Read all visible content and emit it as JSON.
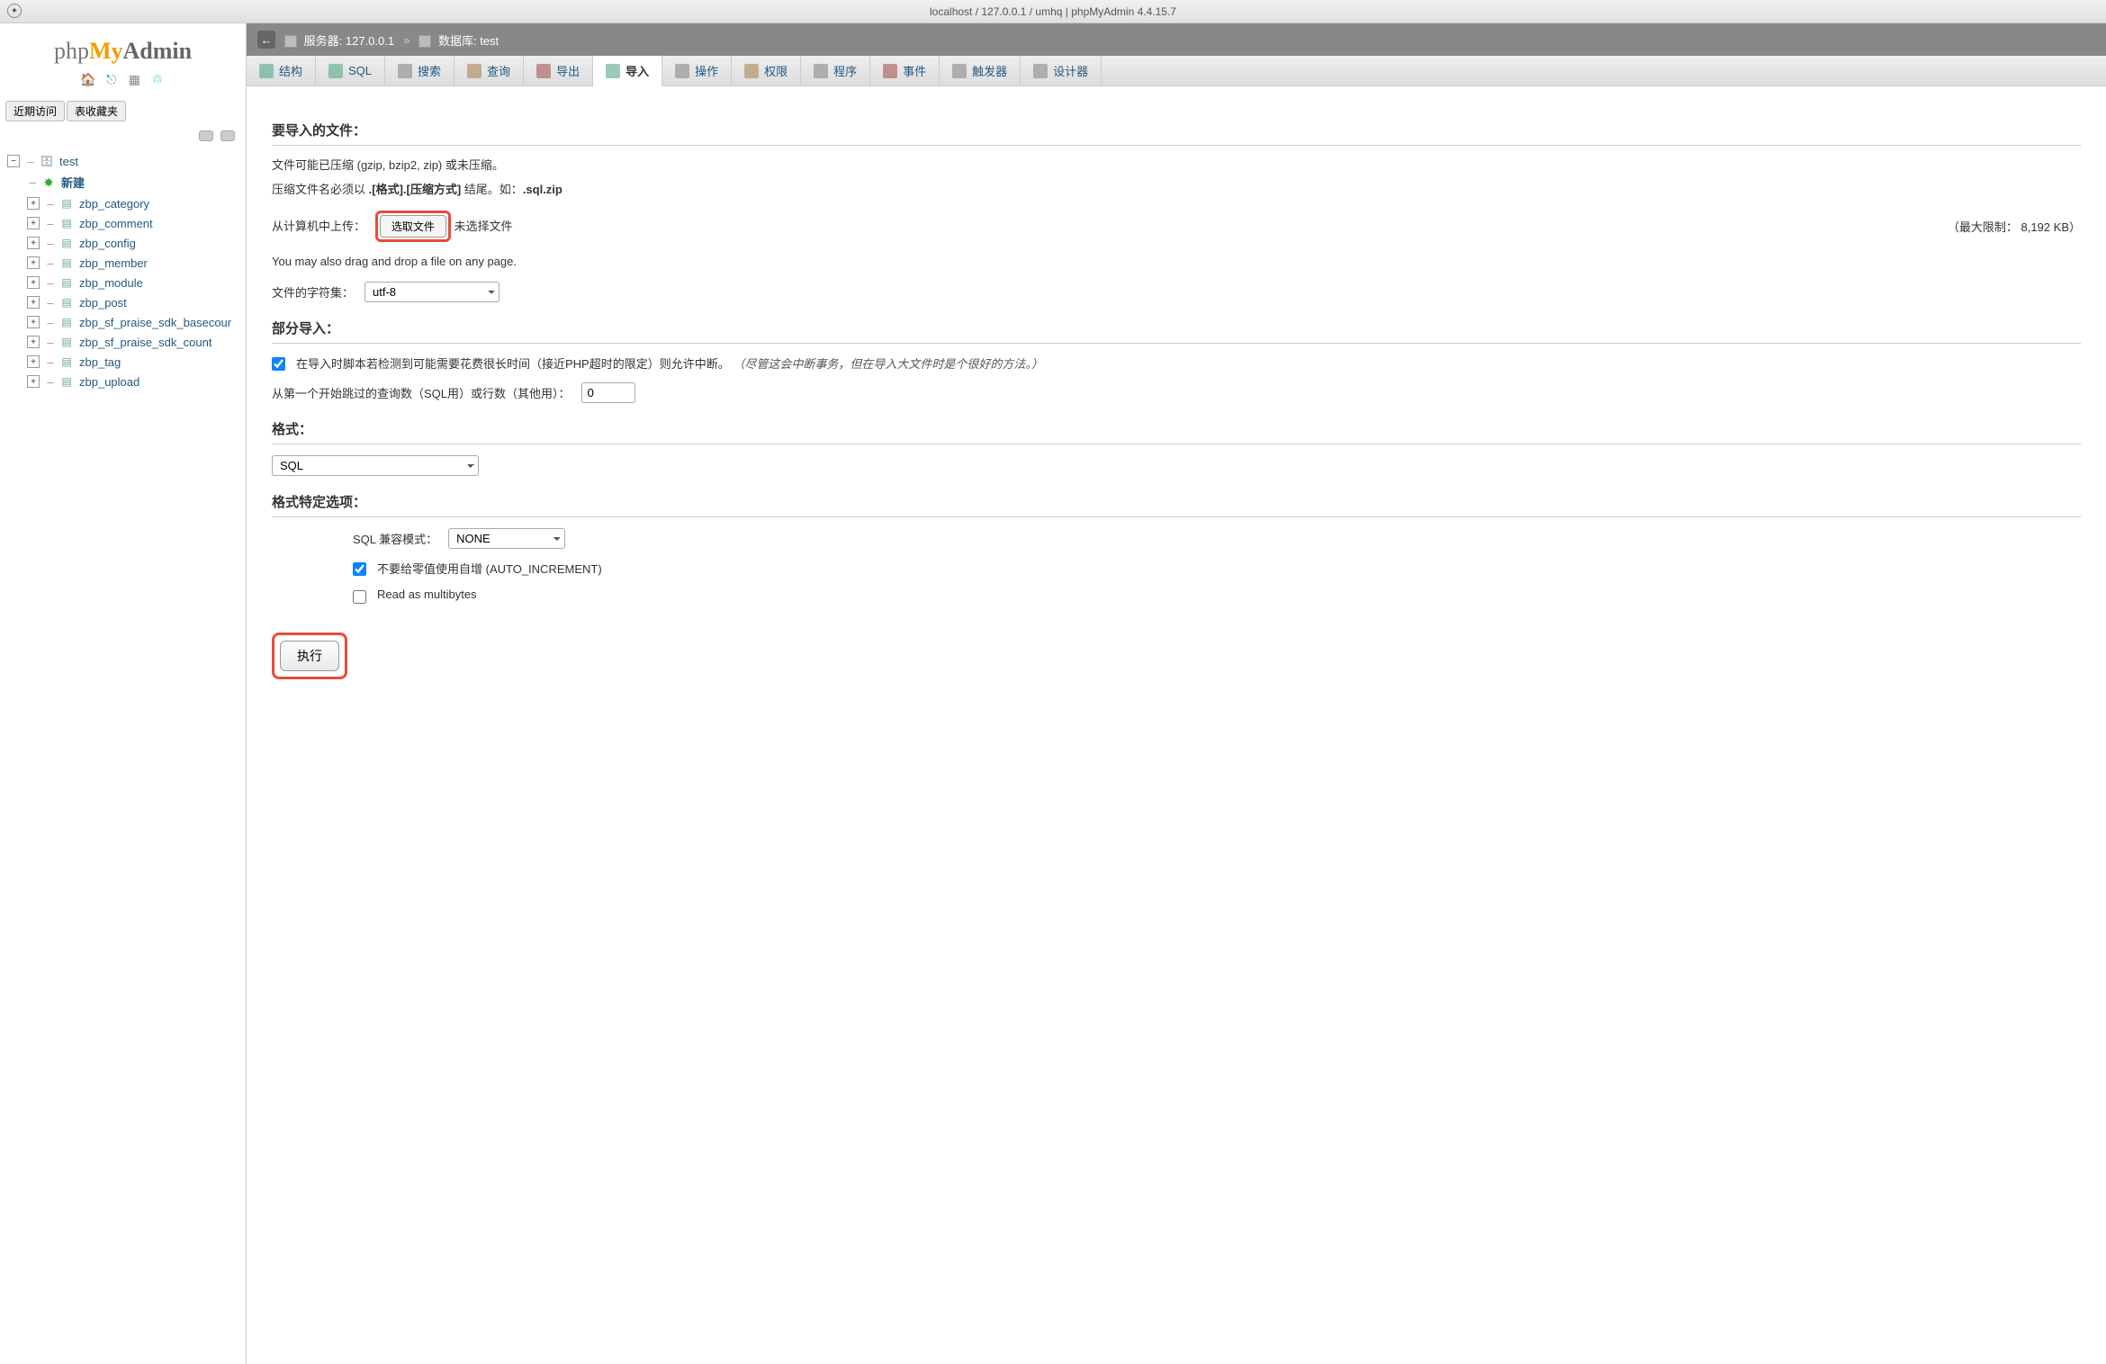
{
  "titlebar": "localhost / 127.0.0.1 / umhq | phpMyAdmin 4.4.15.7",
  "logo": {
    "p1": "php",
    "p2": "My",
    "p3": "Admin"
  },
  "sidebar_tabs": {
    "recent": "近期访问",
    "fav": "表收藏夹"
  },
  "tree": {
    "db": "test",
    "new": "新建",
    "tables": [
      "zbp_category",
      "zbp_comment",
      "zbp_config",
      "zbp_member",
      "zbp_module",
      "zbp_post",
      "zbp_sf_praise_sdk_basecour",
      "zbp_sf_praise_sdk_count",
      "zbp_tag",
      "zbp_upload"
    ]
  },
  "breadcrumb": {
    "server_label": "服务器:",
    "server": "127.0.0.1",
    "db_label": "数据库:",
    "db": "test"
  },
  "tabs": [
    {
      "label": "结构"
    },
    {
      "label": "SQL"
    },
    {
      "label": "搜索"
    },
    {
      "label": "查询"
    },
    {
      "label": "导出"
    },
    {
      "label": "导入",
      "active": true
    },
    {
      "label": "操作"
    },
    {
      "label": "权限"
    },
    {
      "label": "程序"
    },
    {
      "label": "事件"
    },
    {
      "label": "触发器"
    },
    {
      "label": "设计器"
    }
  ],
  "import": {
    "section_file": "要导入的文件：",
    "compress_note": "文件可能已压缩 (gzip, bzip2, zip) 或未压缩。",
    "name_note_prefix": "压缩文件名必须以 ",
    "name_note_bold": ".[格式].[压缩方式]",
    "name_note_suffix": " 结尾。如：",
    "name_note_example": ".sql.zip",
    "upload_label": "从计算机中上传：",
    "choose_file": "选取文件",
    "no_file": "未选择文件",
    "max_limit": "（最大限制： 8,192 KB）",
    "dragdrop": "You may also drag and drop a file on any page.",
    "charset_label": "文件的字符集：",
    "charset_value": "utf-8",
    "section_partial": "部分导入：",
    "partial_check": "在导入时脚本若检测到可能需要花费很长时间（接近PHP超时的限定）则允许中断。",
    "partial_note": "（尽管这会中断事务，但在导入大文件时是个很好的方法。）",
    "skip_label": "从第一个开始跳过的查询数（SQL用）或行数（其他用）：",
    "skip_value": "0",
    "section_format": "格式：",
    "format_value": "SQL",
    "section_format_opts": "格式特定选项：",
    "compat_label": "SQL 兼容模式：",
    "compat_value": "NONE",
    "autoincr": "不要给零值使用自增 (AUTO_INCREMENT)",
    "multibytes": "Read as multibytes",
    "submit": "执行"
  }
}
